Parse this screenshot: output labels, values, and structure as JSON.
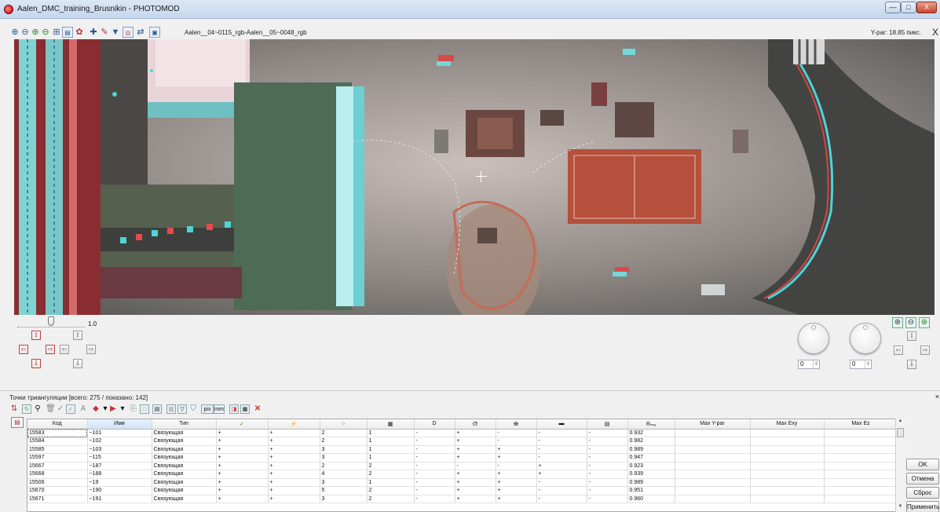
{
  "window": {
    "title": "Aalen_DMC_training_Brusnikin - PHOTOMOD",
    "min": "—",
    "max": "□",
    "close": "X"
  },
  "toolbar": {
    "pair_name": "Aalen__04~0115_rgb-Aalen__05~0048_rgb",
    "ypar": "Y-par: 18.85 пикс.",
    "close": "X"
  },
  "nav": {
    "zoom_value": "1.0",
    "dial1_value": "0",
    "dial2_value": "0"
  },
  "panel": {
    "title": "Точки триангуляции [всего: 275 / показано: 142]",
    "columns": [
      "Код",
      "Имя",
      "Тип",
      "✓",
      "⚡",
      "⁘",
      "▦",
      "D",
      "ⵚ",
      "ⴲ",
      "▬",
      "▤",
      "Rₘₐ",
      "Max Y-par",
      "Max Exy",
      "Max Ez"
    ],
    "rows": [
      [
        "15583",
        "~101",
        "Связующая",
        "+",
        "+",
        "2",
        "1",
        "-",
        "+",
        "-",
        "-",
        "-",
        "0.932",
        "",
        "",
        ""
      ],
      [
        "15584",
        "~102",
        "Связующая",
        "+",
        "+",
        "2",
        "1",
        "-",
        "+",
        "-",
        "-",
        "-",
        "0.982",
        "",
        "",
        ""
      ],
      [
        "15585",
        "~103",
        "Связующая",
        "+",
        "+",
        "3",
        "1",
        "-",
        "+",
        "+",
        "-",
        "-",
        "0.989",
        "",
        "",
        ""
      ],
      [
        "15597",
        "~115",
        "Связующая",
        "+",
        "+",
        "3",
        "1",
        "-",
        "+",
        "+",
        "-",
        "-",
        "0.947",
        "",
        "",
        ""
      ],
      [
        "15667",
        "~187",
        "Связующая",
        "+",
        "+",
        "2",
        "2",
        "-",
        "-",
        "-",
        "+",
        "-",
        "0.923",
        "",
        "",
        ""
      ],
      [
        "15668",
        "~188",
        "Связующая",
        "+",
        "+",
        "4",
        "2",
        "-",
        "+",
        "+",
        "+",
        "-",
        "0.939",
        "",
        "",
        ""
      ],
      [
        "15506",
        "~19",
        "Связующая",
        "+",
        "+",
        "3",
        "1",
        "-",
        "+",
        "+",
        "-",
        "-",
        "0.989",
        "",
        "",
        ""
      ],
      [
        "15670",
        "~190",
        "Связующая",
        "+",
        "+",
        "5",
        "2",
        "-",
        "+",
        "+",
        "-",
        "-",
        "0.951",
        "",
        "",
        ""
      ],
      [
        "15671",
        "~191",
        "Связующая",
        "+",
        "+",
        "3",
        "2",
        "-",
        "+",
        "+",
        "-",
        "-",
        "0.960",
        "",
        "",
        ""
      ]
    ]
  },
  "buttons": {
    "ok": "OK",
    "cancel": "Отмена",
    "reset": "Сброс",
    "apply": "Применить"
  },
  "colors": {
    "accent_red": "#c11111",
    "court": "#b4503c",
    "building_roof": "#4e6b55"
  }
}
